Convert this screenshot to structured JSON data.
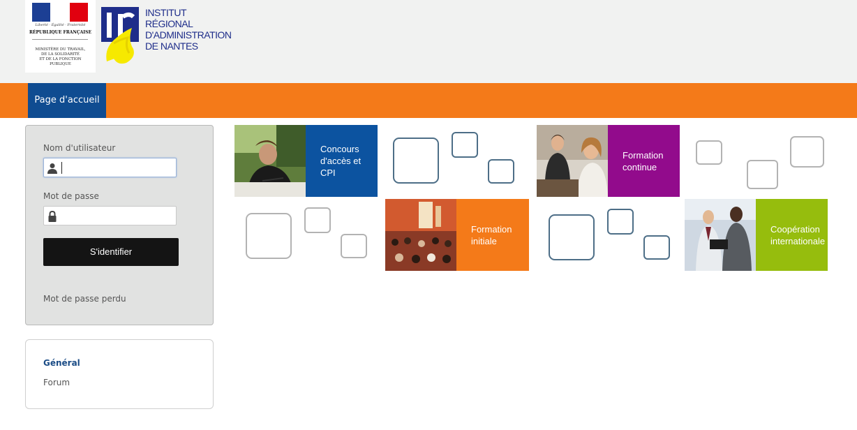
{
  "header": {
    "republique": {
      "motto": "Liberté · Égalité · Fraternité",
      "title": "RÉPUBLIQUE FRANÇAISE",
      "ministry_lines": [
        "MINISTÈRE DU TRAVAIL,",
        "DE LA SOLIDARITÉ",
        "ET DE LA FONCTION",
        "PUBLIQUE"
      ]
    },
    "institute": {
      "lines": [
        "INSTITUT",
        "RÉGIONAL",
        "D'ADMINISTRATION",
        "DE NANTES"
      ]
    }
  },
  "nav": {
    "home_label": "Page d'accueil"
  },
  "login": {
    "username_label": "Nom d'utilisateur",
    "username_value": "",
    "password_label": "Mot de passe",
    "password_value": "",
    "submit_label": "S'identifier",
    "lost_password": "Mot de passe perdu"
  },
  "sidebar_block": {
    "title": "Général",
    "link": "Forum"
  },
  "tiles": [
    {
      "label": "Concours d'accès et CPI",
      "color": "#0c53a0"
    },
    {
      "label": "Formation continue",
      "color": "#920b8c"
    },
    {
      "label": "Formation initiale",
      "color": "#f47a19"
    },
    {
      "label": "Coopération internationale",
      "color": "#96bd0d"
    }
  ],
  "colors": {
    "nav_bar": "#f47a19",
    "nav_active": "#0f4c91",
    "header_bg": "#f1f2f1",
    "login_bg": "#e1e2e1",
    "button": "#141414",
    "block_title": "#1b4c86"
  }
}
